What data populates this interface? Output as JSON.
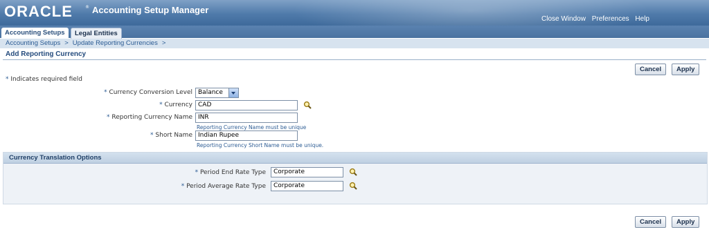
{
  "app": {
    "brand": "ORACLE",
    "registered": "®",
    "title": "Accounting Setup Manager",
    "global_links": [
      "Close Window",
      "Preferences",
      "Help"
    ]
  },
  "tabs": [
    {
      "label": "Accounting Setups",
      "active": true
    },
    {
      "label": "Legal Entities",
      "active": false
    }
  ],
  "breadcrumb": [
    "Accounting Setups",
    "Update Reporting Currencies"
  ],
  "breadcrumb_separator": ">",
  "page": {
    "title": "Add Reporting Currency"
  },
  "buttons": {
    "cancel": "Cancel",
    "apply": "Apply"
  },
  "form": {
    "required_star": "*",
    "required_note": "Indicates required field",
    "conversion_level": {
      "label": "Currency Conversion Level",
      "value": "Balance"
    },
    "currency": {
      "label": "Currency",
      "value": "CAD"
    },
    "reporting_name": {
      "label": "Reporting Currency Name",
      "value": "INR",
      "hint": "Reporting Currency Name must be unique"
    },
    "short_name": {
      "label": "Short Name",
      "value": "Indian Rupee",
      "hint": "Reporting Currency Short Name must be unique."
    }
  },
  "translation": {
    "title": "Currency Translation Options",
    "period_end": {
      "label": "Period End Rate Type",
      "value": "Corporate"
    },
    "period_average": {
      "label": "Period Average Rate Type",
      "value": "Corporate"
    }
  },
  "colors": {
    "header": "#4f7aaa",
    "link": "#2b5b93",
    "section_bg": "#eef2f7"
  }
}
